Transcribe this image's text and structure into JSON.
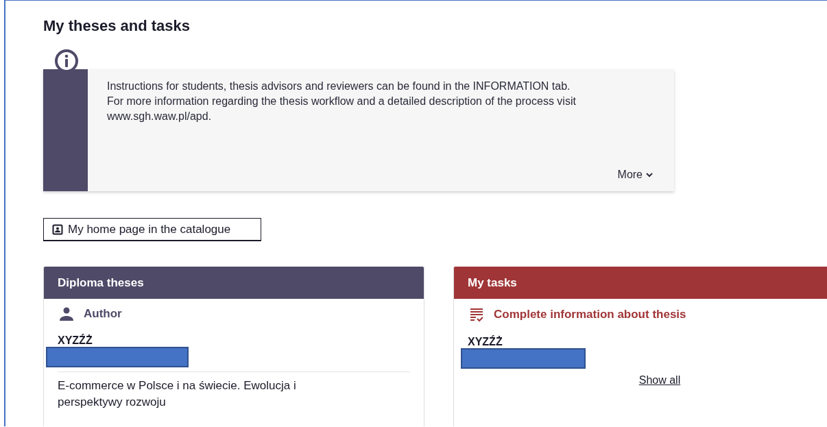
{
  "page_title": "My theses and tasks",
  "info": {
    "lines": [
      "Instructions for students, thesis advisors and reviewers can be found in the INFORMATION tab.",
      "For more information regarding the thesis workflow and a detailed description of the process visit www.sgh.waw.pl/apd."
    ],
    "more": "More",
    "expanded": false
  },
  "catalogue_button": "My home page in the catalogue",
  "theses_card": {
    "title": "Diploma theses",
    "role": "Author",
    "name": "XYZŹŻ",
    "thesis_title": "E-commerce w Polsce i na świecie. Ewolucja i perspektywy rozwoju"
  },
  "tasks_card": {
    "title": "My tasks",
    "task": "Complete information about thesis",
    "name": "XYZŹŻ",
    "show_all": "Show all"
  }
}
